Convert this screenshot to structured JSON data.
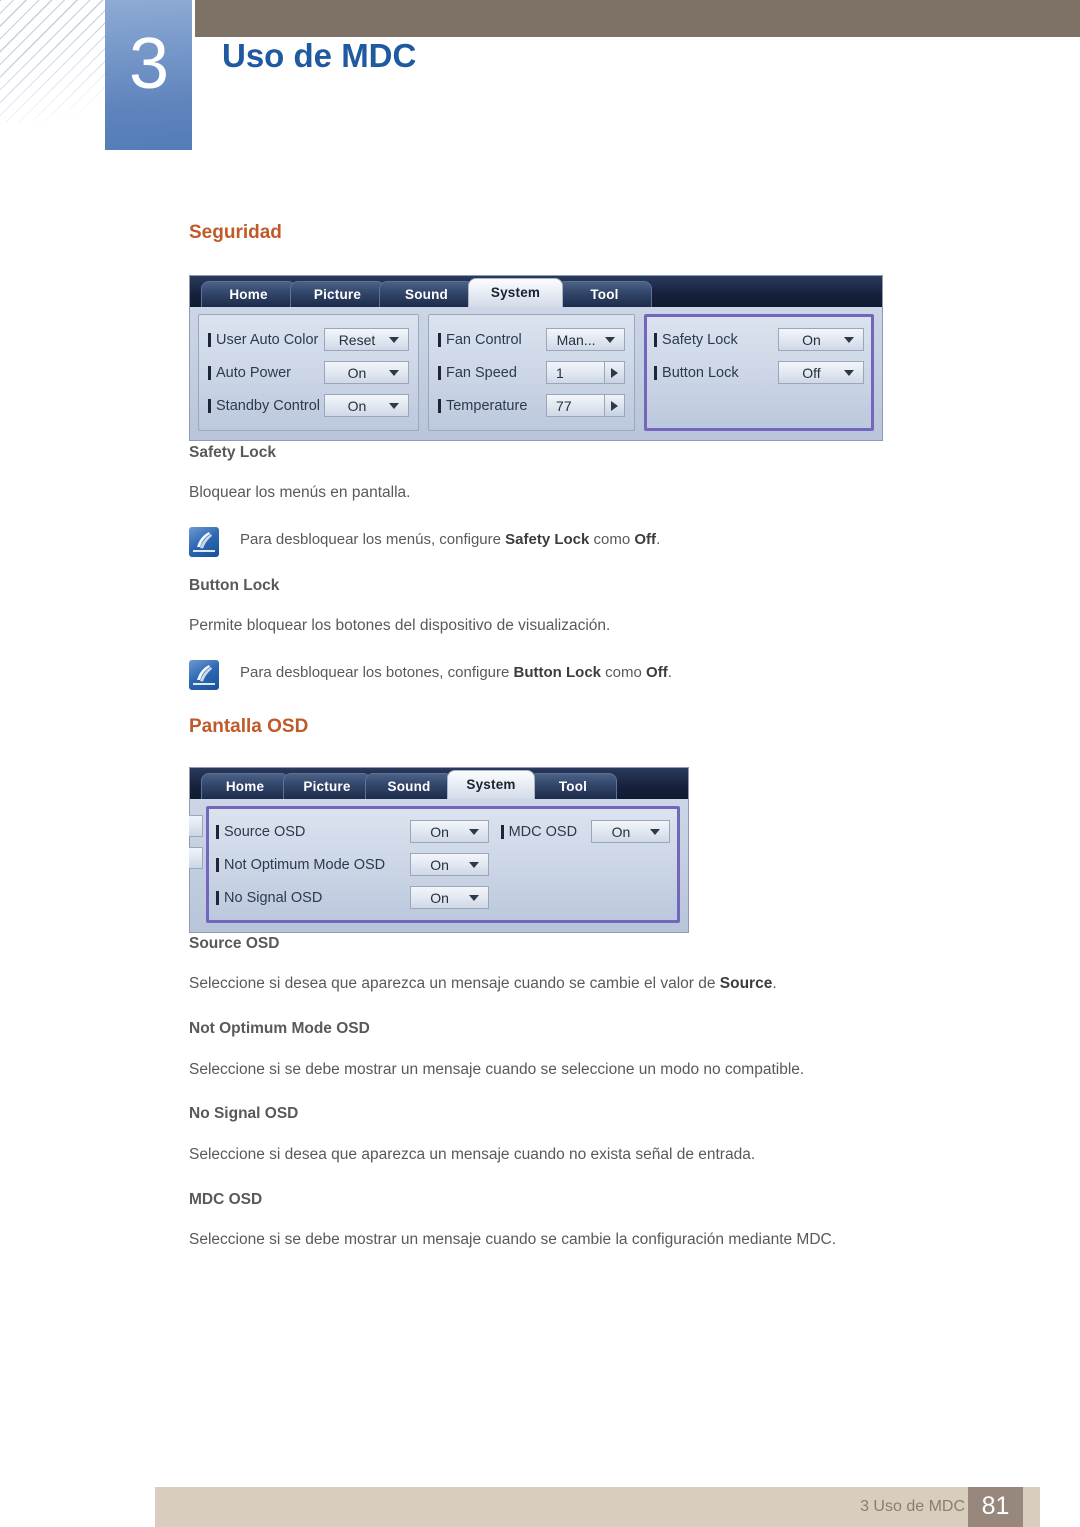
{
  "header": {
    "chapter_number": "3",
    "chapter_title": "Uso de MDC"
  },
  "sections": {
    "seguridad": {
      "heading": "Seguridad",
      "panel": {
        "tabs": [
          {
            "label": "Home",
            "active": false
          },
          {
            "label": "Picture",
            "active": false
          },
          {
            "label": "Sound",
            "active": false
          },
          {
            "label": "System",
            "active": true
          },
          {
            "label": "Tool",
            "active": false
          }
        ],
        "group1": [
          {
            "label": "User Auto Color",
            "value": "Reset",
            "type": "dropdown"
          },
          {
            "label": "Auto Power",
            "value": "On",
            "type": "dropdown"
          },
          {
            "label": "Standby Control",
            "value": "On",
            "type": "dropdown"
          }
        ],
        "group2": [
          {
            "label": "Fan Control",
            "value": "Man...",
            "type": "dropdown"
          },
          {
            "label": "Fan Speed",
            "value": "1",
            "type": "spinner"
          },
          {
            "label": "Temperature",
            "value": "77",
            "type": "spinner"
          }
        ],
        "group3": [
          {
            "label": "Safety Lock",
            "value": "On",
            "type": "dropdown"
          },
          {
            "label": "Button Lock",
            "value": "Off",
            "type": "dropdown"
          }
        ],
        "highlight_color": "#7367bd"
      },
      "items": [
        {
          "title": "Safety Lock",
          "description": "Bloquear los menús en pantalla.",
          "note_prefix": "Para desbloquear los menús, configure ",
          "note_bold1": "Safety Lock",
          "note_mid": " como ",
          "note_bold2": "Off",
          "note_suffix": "."
        },
        {
          "title": "Button Lock",
          "description": "Permite bloquear los botones del dispositivo de visualización.",
          "note_prefix": "Para desbloquear los botones, configure ",
          "note_bold1": "Button Lock",
          "note_mid": " como ",
          "note_bold2": "Off",
          "note_suffix": "."
        }
      ]
    },
    "pantalla_osd": {
      "heading": "Pantalla OSD",
      "panel": {
        "tabs": [
          {
            "label": "Home",
            "active": false
          },
          {
            "label": "Picture",
            "active": false
          },
          {
            "label": "Sound",
            "active": false
          },
          {
            "label": "System",
            "active": true
          },
          {
            "label": "Tool",
            "active": false
          }
        ],
        "group1": [
          {
            "label": "Source OSD",
            "value": "On",
            "type": "dropdown"
          },
          {
            "label": "Not Optimum Mode OSD",
            "value": "On",
            "type": "dropdown"
          },
          {
            "label": "No Signal OSD",
            "value": "On",
            "type": "dropdown"
          }
        ],
        "group2": [
          {
            "label": "MDC OSD",
            "value": "On",
            "type": "dropdown"
          }
        ],
        "highlight_color": "#7367bd"
      },
      "items": [
        {
          "title": "Source OSD",
          "desc_prefix": "Seleccione si desea que aparezca un mensaje cuando se cambie el valor de ",
          "desc_bold": "Source",
          "desc_suffix": "."
        },
        {
          "title": "Not Optimum Mode OSD",
          "desc_prefix": "Seleccione si se debe mostrar un mensaje cuando se seleccione un modo no compatible.",
          "desc_bold": "",
          "desc_suffix": ""
        },
        {
          "title": "No Signal OSD",
          "desc_prefix": "Seleccione si desea que aparezca un mensaje cuando no exista señal de entrada.",
          "desc_bold": "",
          "desc_suffix": ""
        },
        {
          "title": "MDC OSD",
          "desc_prefix": "Seleccione si se debe mostrar un mensaje cuando se cambie la configuración mediante MDC.",
          "desc_bold": "",
          "desc_suffix": ""
        }
      ]
    }
  },
  "footer": {
    "label": "3 Uso de MDC",
    "page_number": "81"
  },
  "colors": {
    "accent_orange": "#c05a28",
    "chapter_blue": "#1f5aa0",
    "brown_bar": "#7e7166",
    "footer_bar": "#d9cdbd",
    "page_box": "#97877c"
  }
}
